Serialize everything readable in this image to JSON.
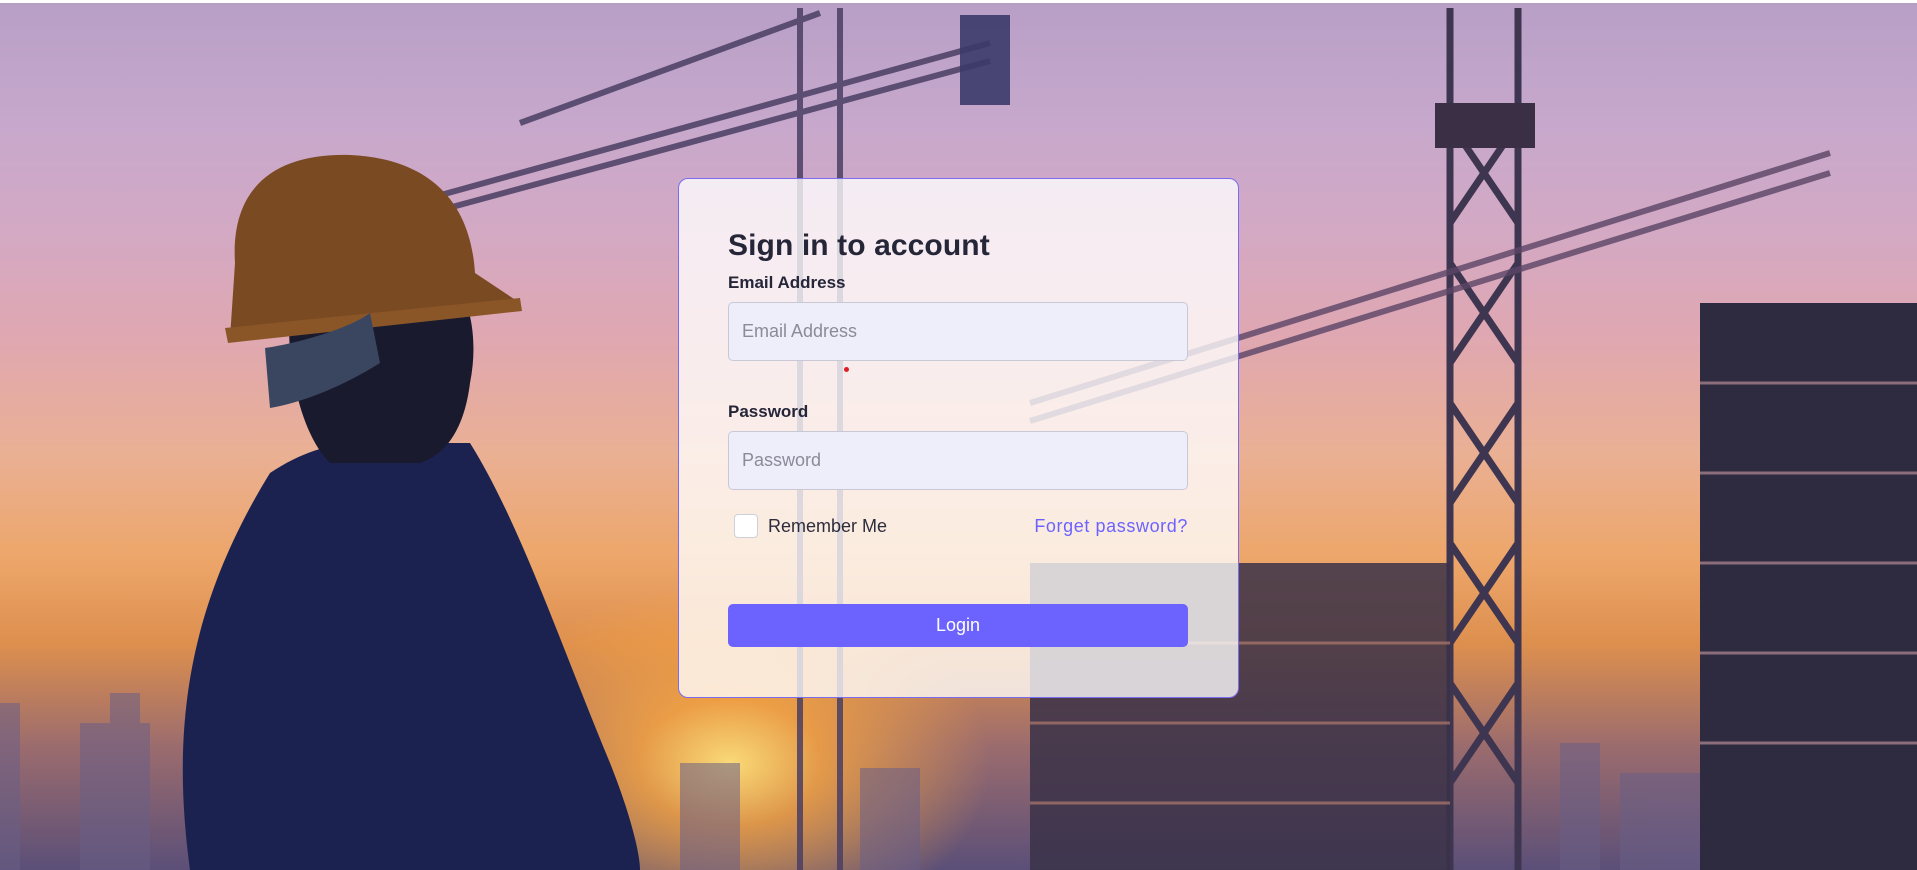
{
  "login": {
    "title": "Sign in to account",
    "email_label": "Email Address",
    "email_placeholder": "Email Address",
    "email_value": "",
    "password_label": "Password",
    "password_placeholder": "Password",
    "password_value": "",
    "remember_label": "Remember Me",
    "remember_checked": false,
    "forgot_label": "Forget password?",
    "login_label": "Login"
  },
  "colors": {
    "accent": "#6c63ff",
    "card_border": "#7a6cf0",
    "input_bg": "#eeeefb",
    "title_text": "#262639"
  },
  "background": {
    "scene": "construction-worker-silhouette-at-sunset",
    "icons": [
      "hard-hat-worker-silhouette",
      "tower-crane",
      "building-under-construction"
    ]
  }
}
